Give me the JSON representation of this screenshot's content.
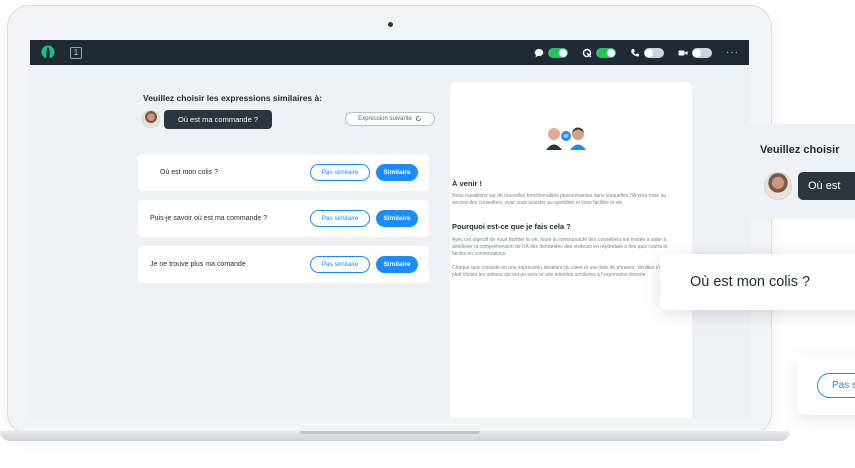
{
  "topbar": {
    "counter": "1",
    "logo_icon": "chat-logo-icon",
    "controls": [
      {
        "icon": "chat-bubble-icon",
        "state": "on"
      },
      {
        "icon": "cobrowse-icon",
        "state": "on"
      },
      {
        "icon": "phone-icon",
        "state": "off"
      },
      {
        "icon": "video-icon",
        "state": "off"
      }
    ],
    "more": "···"
  },
  "quiz": {
    "title": "Veuillez choisir les expressions similaires à:",
    "expression": "Où est ma commande ?",
    "next_label": "Expression suivante",
    "items": [
      {
        "text": "Où est mon colis ?",
        "not_similar": "Pas similaire",
        "similar": "Similaire"
      },
      {
        "text": "Puis-je savoir où est ma commande ?",
        "not_similar": "Pas similaire",
        "similar": "Similaire"
      },
      {
        "text": "Je ne trouve plus ma comande",
        "not_similar": "Pas similaire",
        "similar": "Similaire"
      }
    ]
  },
  "panel": {
    "heading1": "À venir !",
    "text1": "Nous travaillons sur de nouvelles fonctionnalités passionnantes dans lesquelles l'IA sera mise au service des conseillers, pour vous assister au quotidien et vous faciliter la vie.",
    "heading2": "Pourquoi est-ce que je fais cela ?",
    "text2": "Avec cet objectif de vous faciliter la vie, toute la communauté des conseillers est invitée à aider à améliorer la compréhension de l'IA des demandes des visiteurs en répondant à des quiz courts et faciles en conversations.",
    "text3": "Chaque quiz consiste en une expression aléatoire du client et une liste de phrases. Veuillez s'il vous plaît choisir les options qui ont un sens et une intention similaires à l'expression donnée."
  },
  "zoom": {
    "title": "Veuillez choisir",
    "expression": "Où est",
    "item_text": "Où est mon colis ?",
    "not_similar": "Pas s"
  },
  "colors": {
    "accent": "#1a8cff",
    "toggle_on": "#22c55e",
    "topbar": "#1f2a34",
    "bubble": "#2d363f",
    "logo": "#19c37d"
  }
}
